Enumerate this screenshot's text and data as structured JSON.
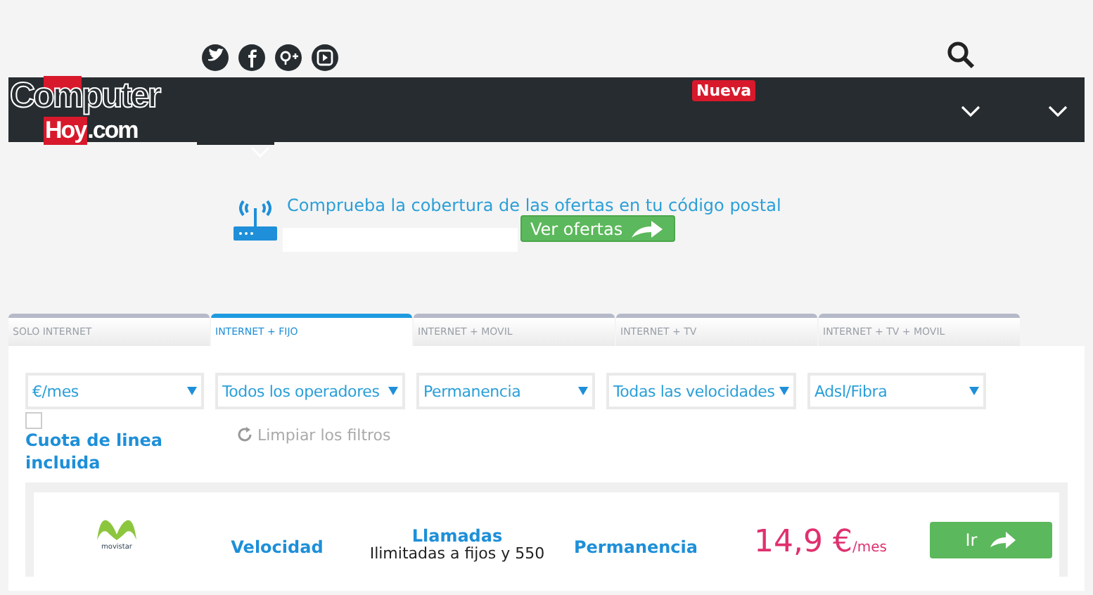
{
  "social_links": [
    {
      "kind": "twitter"
    },
    {
      "kind": "facebook"
    },
    {
      "kind": "googleplus"
    },
    {
      "kind": "youtube"
    }
  ],
  "header": {
    "logo": {
      "line1": "Computer",
      "line2": "Hoy",
      "line3": ".com"
    },
    "badge": "Nueva"
  },
  "coverage": {
    "prompt": "Comprueba la cobertura de las ofertas en tu código postal",
    "button": "Ver ofertas"
  },
  "tabs": [
    {
      "label": "SOLO INTERNET",
      "selected": false
    },
    {
      "label": "INTERNET + FIJO",
      "selected": true
    },
    {
      "label": "INTERNET + MOVIL",
      "selected": false
    },
    {
      "label": "INTERNET + TV",
      "selected": false
    },
    {
      "label": "INTERNET + TV + MOVIL",
      "selected": false
    }
  ],
  "filters": [
    {
      "value": "€/mes"
    },
    {
      "value": "Todos los operadores"
    },
    {
      "value": "Permanencia"
    },
    {
      "value": "Todas las velocidades"
    },
    {
      "value": "Adsl/Fibra"
    }
  ],
  "line_fee": {
    "label": "Cuota de linea incluida",
    "checked": false
  },
  "clear_filters": "Limpiar los filtros",
  "offer": {
    "operator": "movistar",
    "speed_label": "Velocidad",
    "calls_label": "Llamadas",
    "calls_detail": "Ilimitadas a fijos y 550",
    "commitment_label": "Permanencia",
    "price": "14,9 €",
    "price_unit": "/mes",
    "button": "Ir"
  }
}
